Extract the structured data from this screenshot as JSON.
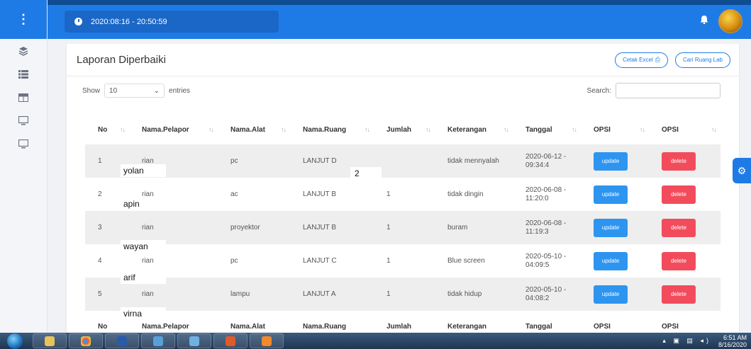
{
  "topbar": {
    "datetime": "2020:08:16 - 20:50:59"
  },
  "sidebar": {
    "menu_glyph": "⋮",
    "icons": [
      "layers-icon",
      "list-icon",
      "table-icon",
      "monitor-icon",
      "monitor-icon"
    ]
  },
  "card": {
    "title": "Laporan Diperbaiki",
    "cetak_excel": "Cetak Excel",
    "cari_ruang": "Cari Ruang Lab"
  },
  "controls": {
    "show": "Show",
    "entries_value": "10",
    "entries": "entries",
    "search": "Search:"
  },
  "table": {
    "headers": [
      "No",
      "Nama.Pelapor",
      "Nama.Alat",
      "Nama.Ruang",
      "Jumlah",
      "Keterangan",
      "Tanggal",
      "OPSI",
      "OPSI"
    ],
    "rows": [
      {
        "no": "1",
        "pelapor": "rian",
        "alat": "pc",
        "ruang": "LANJUT D",
        "jumlah": "",
        "ket": "tidak mennyalah",
        "tanggal": "2020-06-12 - 09:34:4",
        "update": "update",
        "delete": "delete"
      },
      {
        "no": "2",
        "pelapor": "rian",
        "alat": "ac",
        "ruang": "LANJUT B",
        "jumlah": "1",
        "ket": "tidak dingin",
        "tanggal": "2020-06-08 - 11:20:0",
        "update": "update",
        "delete": "delete"
      },
      {
        "no": "3",
        "pelapor": "rian",
        "alat": "proyektor",
        "ruang": "LANJUT B",
        "jumlah": "1",
        "ket": "buram",
        "tanggal": "2020-06-08 - 11:19:3",
        "update": "update",
        "delete": "delete"
      },
      {
        "no": "4",
        "pelapor": "rian",
        "alat": "pc",
        "ruang": "LANJUT C",
        "jumlah": "1",
        "ket": "Blue screen",
        "tanggal": "2020-05-10 - 04:09:5",
        "update": "update",
        "delete": "delete"
      },
      {
        "no": "5",
        "pelapor": "rian",
        "alat": "lampu",
        "ruang": "LANJUT A",
        "jumlah": "1",
        "ket": "tidak hidup",
        "tanggal": "2020-05-10 - 04:08:2",
        "update": "update",
        "delete": "delete"
      }
    ],
    "overlays": [
      "yolan",
      "apin",
      "wayan",
      "arif",
      "virna"
    ],
    "overlay_jumlah": "2"
  },
  "taskbar": {
    "time": "6:51 AM",
    "date": "8/16/2020"
  }
}
